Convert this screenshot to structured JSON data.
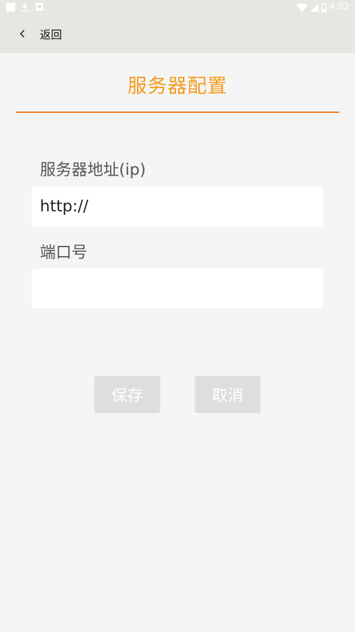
{
  "status_bar": {
    "time": "4:02",
    "icons": [
      "notification-square-icon",
      "download-icon",
      "photo-icon",
      "wifi-icon",
      "signal-icon",
      "battery-icon"
    ]
  },
  "app_bar": {
    "back_label": "返回",
    "background": "#e6e7e2"
  },
  "page": {
    "title": "服务器配置",
    "title_color": "#f39a1b",
    "divider_color": "#ec7a20"
  },
  "form": {
    "server_label": "服务器地址(ip)",
    "server_value": "http://",
    "port_label": "端口号",
    "port_value": ""
  },
  "actions": {
    "save_label": "保存",
    "cancel_label": "取消",
    "button_background": "#dedede"
  }
}
